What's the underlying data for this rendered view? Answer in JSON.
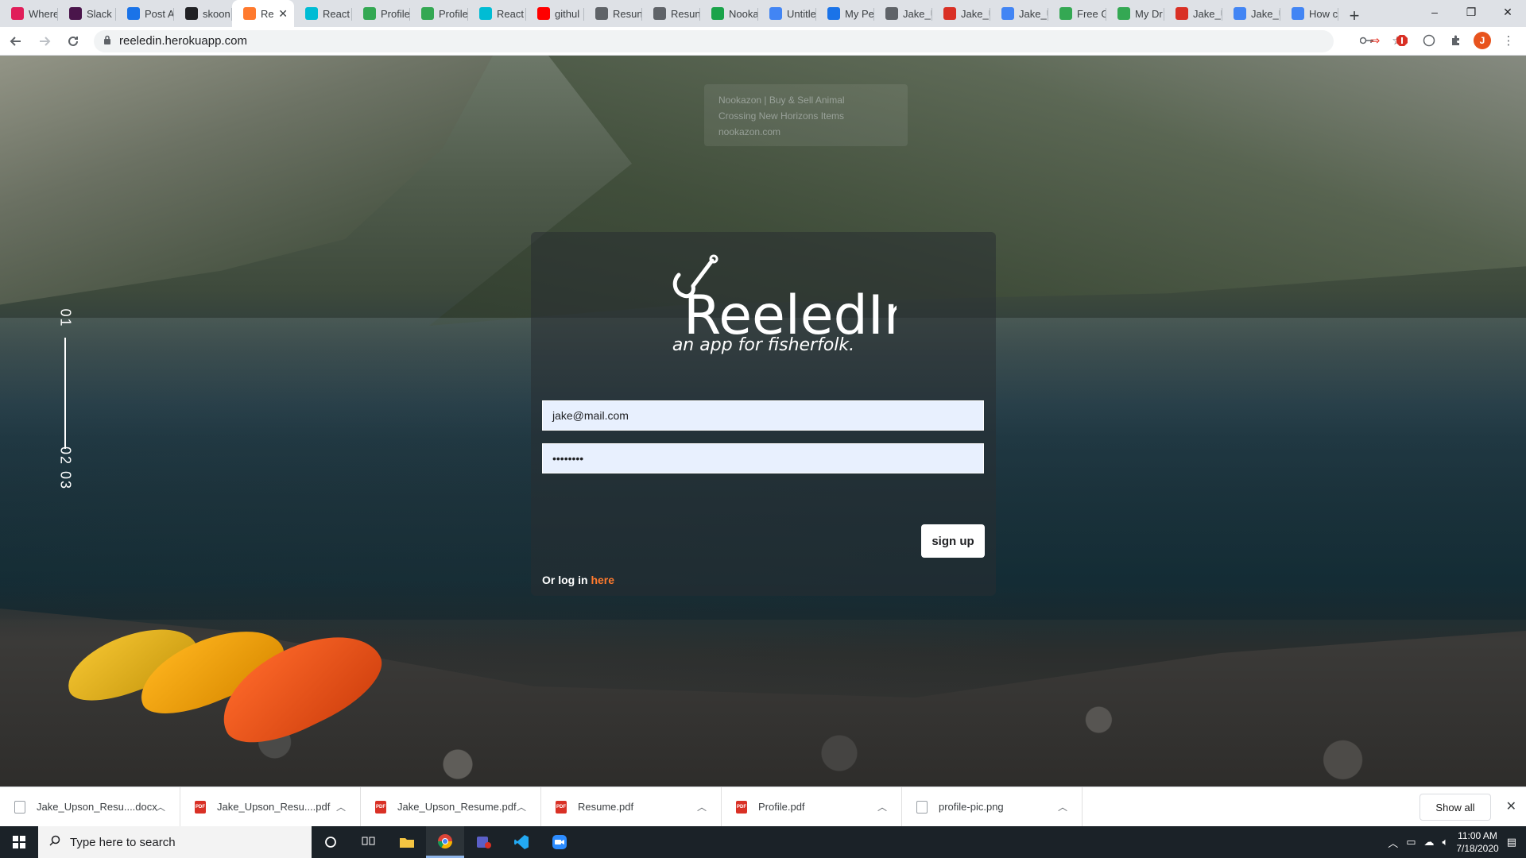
{
  "browser": {
    "tabs": [
      {
        "title": "Where",
        "fav_color": "#e01e5a"
      },
      {
        "title": "Slack |",
        "fav_color": "#4a154b"
      },
      {
        "title": "Post A",
        "fav_color": "#1a73e8"
      },
      {
        "title": "skoon",
        "fav_color": "#202124"
      },
      {
        "title": "Re",
        "fav_color": "#ff7a2e",
        "active": true
      },
      {
        "title": "React",
        "fav_color": "#00bcd4"
      },
      {
        "title": "Profile",
        "fav_color": "#34a853"
      },
      {
        "title": "Profile",
        "fav_color": "#34a853"
      },
      {
        "title": "React",
        "fav_color": "#00bcd4"
      },
      {
        "title": "githul",
        "fav_color": "#ff0000"
      },
      {
        "title": "Resun",
        "fav_color": "#5f6368"
      },
      {
        "title": "Resun",
        "fav_color": "#5f6368"
      },
      {
        "title": "Nooka",
        "fav_color": "#1aa34a"
      },
      {
        "title": "Untitle",
        "fav_color": "#4285f4"
      },
      {
        "title": "My Pe",
        "fav_color": "#1a73e8"
      },
      {
        "title": "Jake_U",
        "fav_color": "#5f6368"
      },
      {
        "title": "Jake_U",
        "fav_color": "#d93025"
      },
      {
        "title": "Jake_U",
        "fav_color": "#4285f4"
      },
      {
        "title": "Free G",
        "fav_color": "#34a853"
      },
      {
        "title": "My Dr",
        "fav_color": "#34a853"
      },
      {
        "title": "Jake_U",
        "fav_color": "#d93025"
      },
      {
        "title": "Jake_U",
        "fav_color": "#4285f4"
      },
      {
        "title": "How c",
        "fav_color": "#4285f4"
      }
    ],
    "new_tab_label": "+",
    "window_controls": {
      "minimize": "–",
      "restore": "❐",
      "close": "✕"
    },
    "url": "reeledin.herokuapp.com",
    "profile_initial": "J"
  },
  "tooltip": {
    "line1": "Nookazon | Buy & Sell Animal",
    "line2": "Crossing New Horizons Items",
    "line3": "nookazon.com"
  },
  "hero": {
    "side_index": {
      "top": "01",
      "bottom": "02  03"
    }
  },
  "login_card": {
    "logo_text": "ReeledIn",
    "tagline": "an app for fisherfolk.",
    "email_value": "jake@mail.com",
    "password_value": "••••••••",
    "signup_label": "sign up",
    "login_prefix": "Or log in ",
    "login_link": "here"
  },
  "downloads": {
    "items": [
      {
        "name": "Jake_Upson_Resu....docx",
        "type": "doc"
      },
      {
        "name": "Jake_Upson_Resu....pdf",
        "type": "pdf"
      },
      {
        "name": "Jake_Upson_Resume.pdf",
        "type": "pdf"
      },
      {
        "name": "Resume.pdf",
        "type": "pdf"
      },
      {
        "name": "Profile.pdf",
        "type": "pdf"
      },
      {
        "name": "profile-pic.png",
        "type": "img"
      }
    ],
    "show_all_label": "Show all"
  },
  "taskbar": {
    "search_placeholder": "Type here to search",
    "time": "11:00 AM",
    "date": "7/18/2020"
  }
}
